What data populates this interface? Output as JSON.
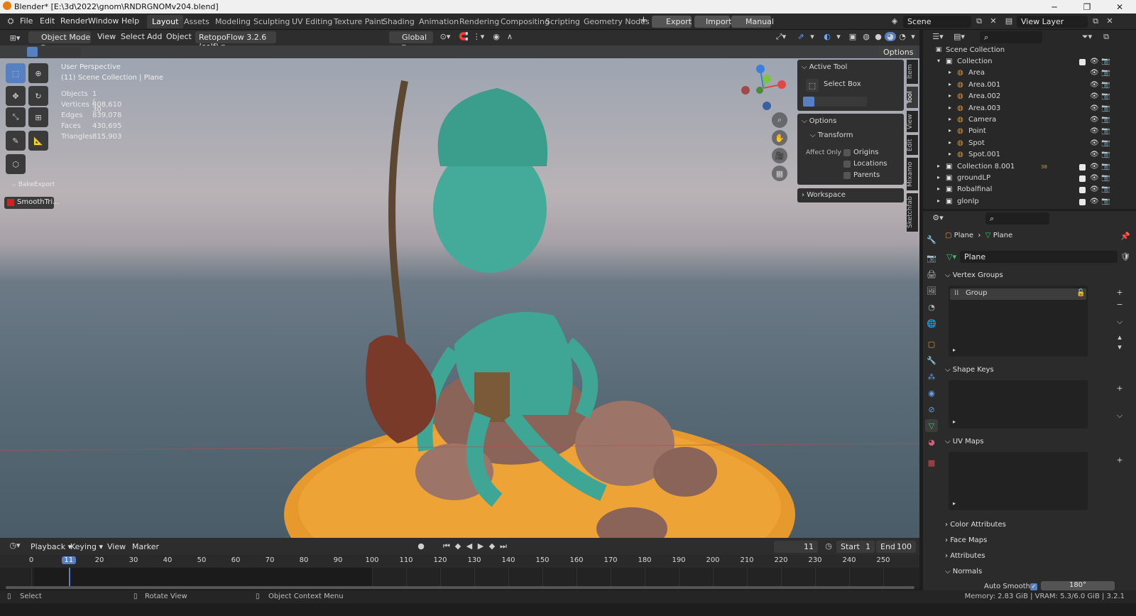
{
  "window": {
    "title": "Blender* [E:\\3d\\2022\\gnom\\RNDRGNOMv204.blend]"
  },
  "menus": [
    "File",
    "Edit",
    "Render",
    "Window",
    "Help"
  ],
  "workspaces": [
    "Layout",
    "Assets",
    "Modeling",
    "Sculpting",
    "UV Editing",
    "Texture Paint",
    "Shading",
    "Animation",
    "Rendering",
    "Compositing",
    "Scripting",
    "Geometry Nodes"
  ],
  "addon_buttons": {
    "export": "Export",
    "import": "Import",
    "manual": "Manual"
  },
  "scene": {
    "name": "Scene",
    "view_layer": "View Layer"
  },
  "viewport_header": {
    "mode": "Object Mode",
    "view": "View",
    "select": "Select",
    "add": "Add",
    "object": "Object",
    "addon": "RetopoFlow 3.2.6 (self)",
    "orientation": "Global",
    "options": "Options"
  },
  "overlay_text": {
    "perspective": "User Perspective",
    "collection": "(11) Scene Collection | Plane"
  },
  "stats": [
    {
      "label": "Objects",
      "value": "1 / 30"
    },
    {
      "label": "Vertices",
      "value": "408,610"
    },
    {
      "label": "Edges",
      "value": "839,078"
    },
    {
      "label": "Faces",
      "value": "430,695"
    },
    {
      "label": "Triangles",
      "value": "815,903"
    }
  ],
  "bake_panel": {
    "header": "BakeExport",
    "button": "SmoothTri..."
  },
  "active_tool": {
    "header": "Active Tool",
    "tool": "Select Box",
    "options": "Options",
    "transform": "Transform",
    "affect_only": "Affect Only",
    "origins": "Origins",
    "locations": "Locations",
    "parents": "Parents",
    "workspace": "Workspace"
  },
  "side_tabs": [
    "Item",
    "Tool",
    "View",
    "Edit",
    "Mixamo",
    "Sketchfab"
  ],
  "outliner": {
    "root": "Scene Collection",
    "items": [
      {
        "name": "Collection",
        "level": 1,
        "kind": "collection"
      },
      {
        "name": "Area",
        "level": 2,
        "kind": "light"
      },
      {
        "name": "Area.001",
        "level": 2,
        "kind": "light"
      },
      {
        "name": "Area.002",
        "level": 2,
        "kind": "light"
      },
      {
        "name": "Area.003",
        "level": 2,
        "kind": "light"
      },
      {
        "name": "Camera",
        "level": 2,
        "kind": "camera"
      },
      {
        "name": "Point",
        "level": 2,
        "kind": "light"
      },
      {
        "name": "Spot",
        "level": 2,
        "kind": "light"
      },
      {
        "name": "Spot.001",
        "level": 2,
        "kind": "light"
      },
      {
        "name": "Collection 8.001",
        "level": 1,
        "kind": "collection",
        "badge": "38"
      },
      {
        "name": "groundLP",
        "level": 1,
        "kind": "collection"
      },
      {
        "name": "Robalfinal",
        "level": 1,
        "kind": "collection"
      },
      {
        "name": "glonlp",
        "level": 1,
        "kind": "collection"
      }
    ]
  },
  "properties": {
    "breadcrumb_object": "Plane",
    "breadcrumb_data": "Plane",
    "mesh_name": "Plane",
    "vertex_groups": "Vertex Groups",
    "group_item": "Group",
    "shape_keys": "Shape Keys",
    "uv_maps": "UV Maps",
    "color_attributes": "Color Attributes",
    "face_maps": "Face Maps",
    "attributes": "Attributes",
    "normals": "Normals",
    "auto_smooth": "Auto Smooth",
    "auto_smooth_angle": "180°"
  },
  "timeline": {
    "menus": [
      "Playback",
      "Keying",
      "View",
      "Marker"
    ],
    "current_frame": "11",
    "start_label": "Start",
    "start": "1",
    "end_label": "End",
    "end": "100",
    "ticks": [
      "0",
      "11",
      "20",
      "30",
      "40",
      "50",
      "60",
      "70",
      "80",
      "90",
      "100",
      "110",
      "120",
      "130",
      "140",
      "150",
      "160",
      "170",
      "180",
      "190",
      "200",
      "210",
      "220",
      "230",
      "240",
      "250"
    ]
  },
  "status": {
    "select": "Select",
    "rotate": "Rotate View",
    "context": "Object Context Menu",
    "memory": "Memory: 2.83 GiB | VRAM: 5.3/6.0 GiB | 3.2.1"
  }
}
